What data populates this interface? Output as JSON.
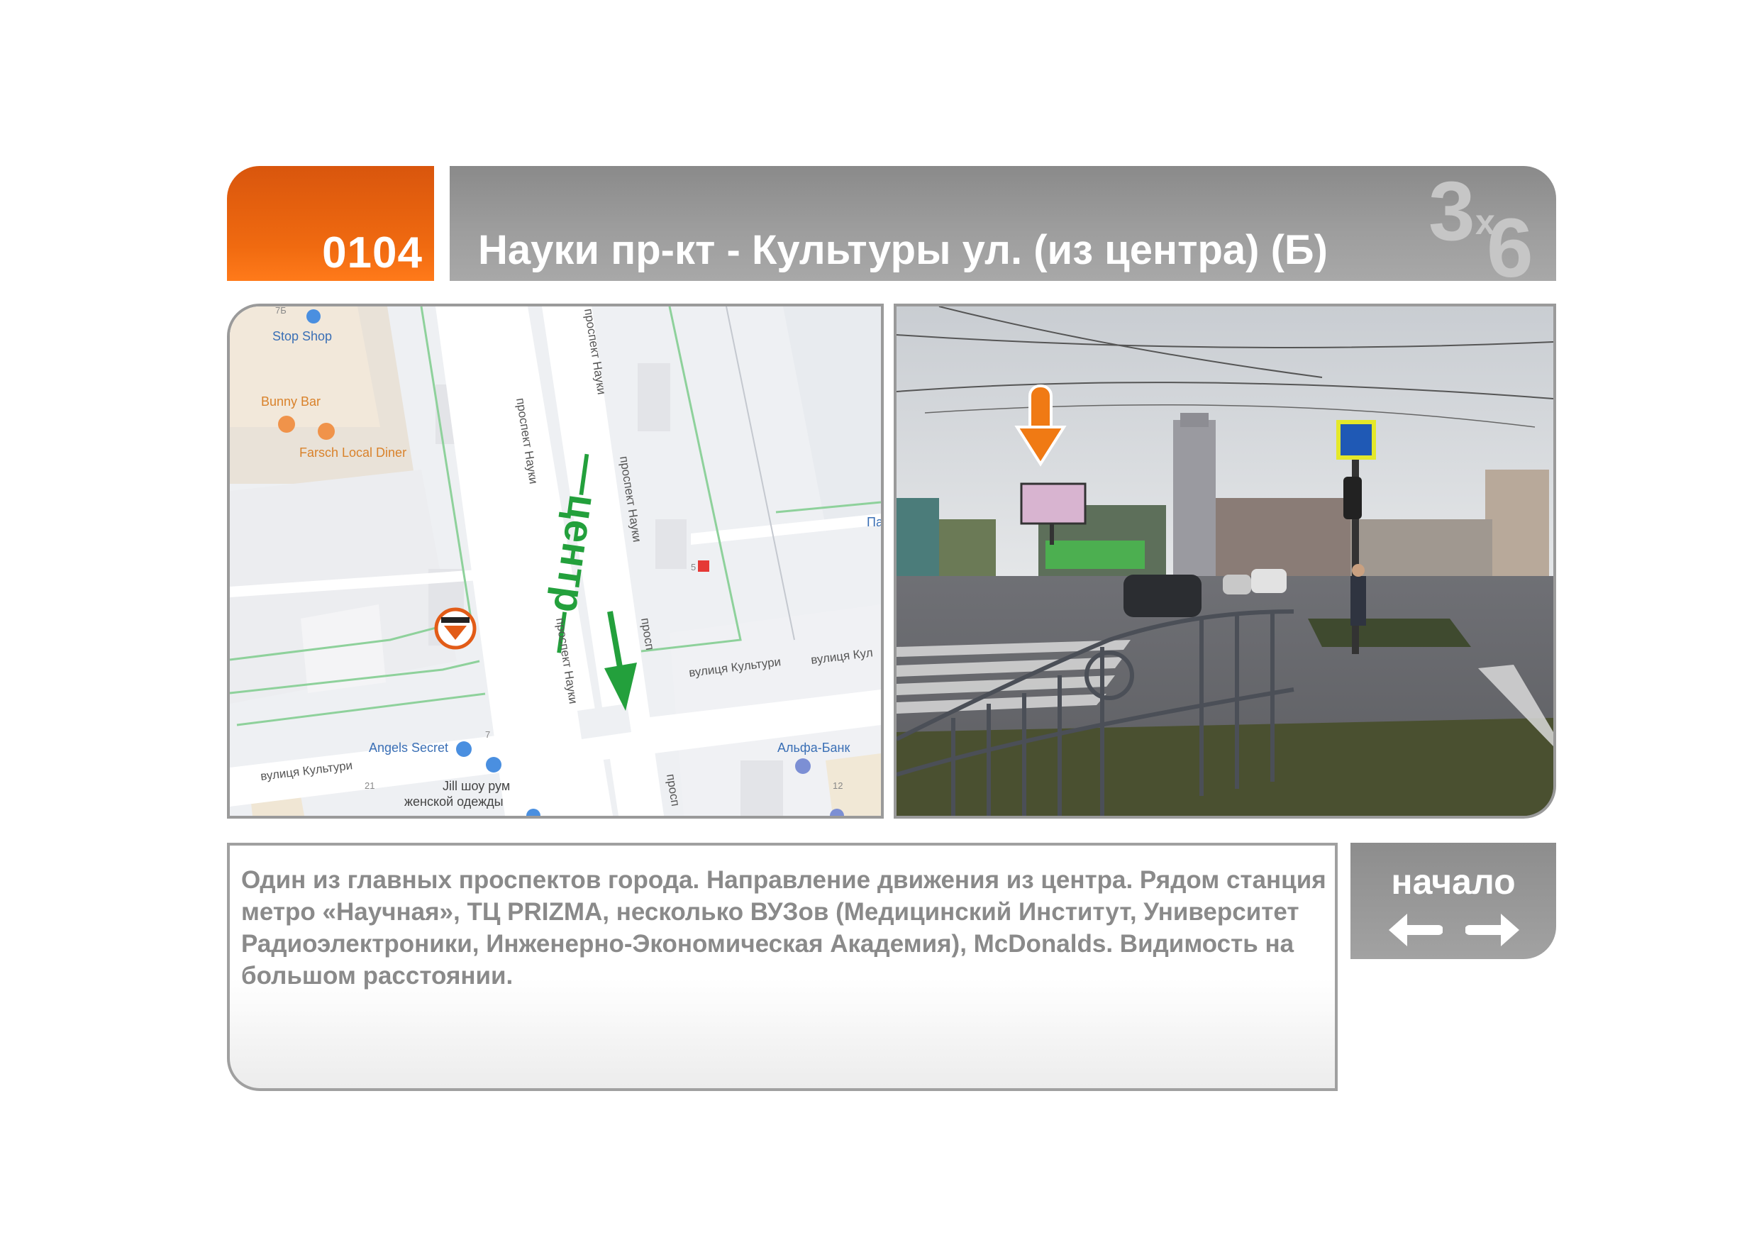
{
  "header": {
    "code": "0104",
    "title": "Науки пр-кт - Культуры ул. (из центра)  (Б)",
    "logo": {
      "digit_big": "3",
      "letter": "x",
      "digit_small": "6",
      "color": "#d0d0d0"
    }
  },
  "map": {
    "streets": {
      "nauky_1": "проспект Науки",
      "nauky_2": "проспект Науки",
      "nauky_3": "проспект Науки",
      "nauky_4": "проспект Науки",
      "nauky_5": "просп",
      "kultury_1": "вулиця Культури",
      "kultury_2": "вулиця Культури",
      "kultury_3": "вулиця Кул"
    },
    "pois": {
      "stop_shop": "Stop Shop",
      "bunny_bar": "Bunny Bar",
      "farsch": "Farsch Local Diner",
      "angels_secret": "Angels Secret",
      "alfa_bank": "Альфа-Банк",
      "jill_line1": "Jill шоу рум",
      "jill_line2": "женской одежды",
      "edge_pa": "Па"
    },
    "numbers": {
      "n7b": "7Б",
      "n5": "5",
      "n7": "7",
      "n21": "21",
      "n12": "12"
    },
    "direction_label": "—центр—",
    "direction_color": "#23a03c",
    "marker_color": "#e25c18"
  },
  "photo": {
    "arrow_color": "#f07a14"
  },
  "description": "Один из главных проспектов города. Направление движения из центра. Рядом станция метро «Научная», ТЦ PRIZMA, несколько ВУЗов (Медицинский Институт, Университет Радиоэлектроники, Инженерно-Экономическая Академия), McDonalds. Видимость на большом расстоянии.",
  "nav": {
    "label": "начало",
    "prev_icon": "arrow-left-icon",
    "next_icon": "arrow-right-icon"
  },
  "colors": {
    "accent": "#f06a10",
    "header_gray": "#9d9d9d",
    "text_gray": "#8a8a8a"
  }
}
